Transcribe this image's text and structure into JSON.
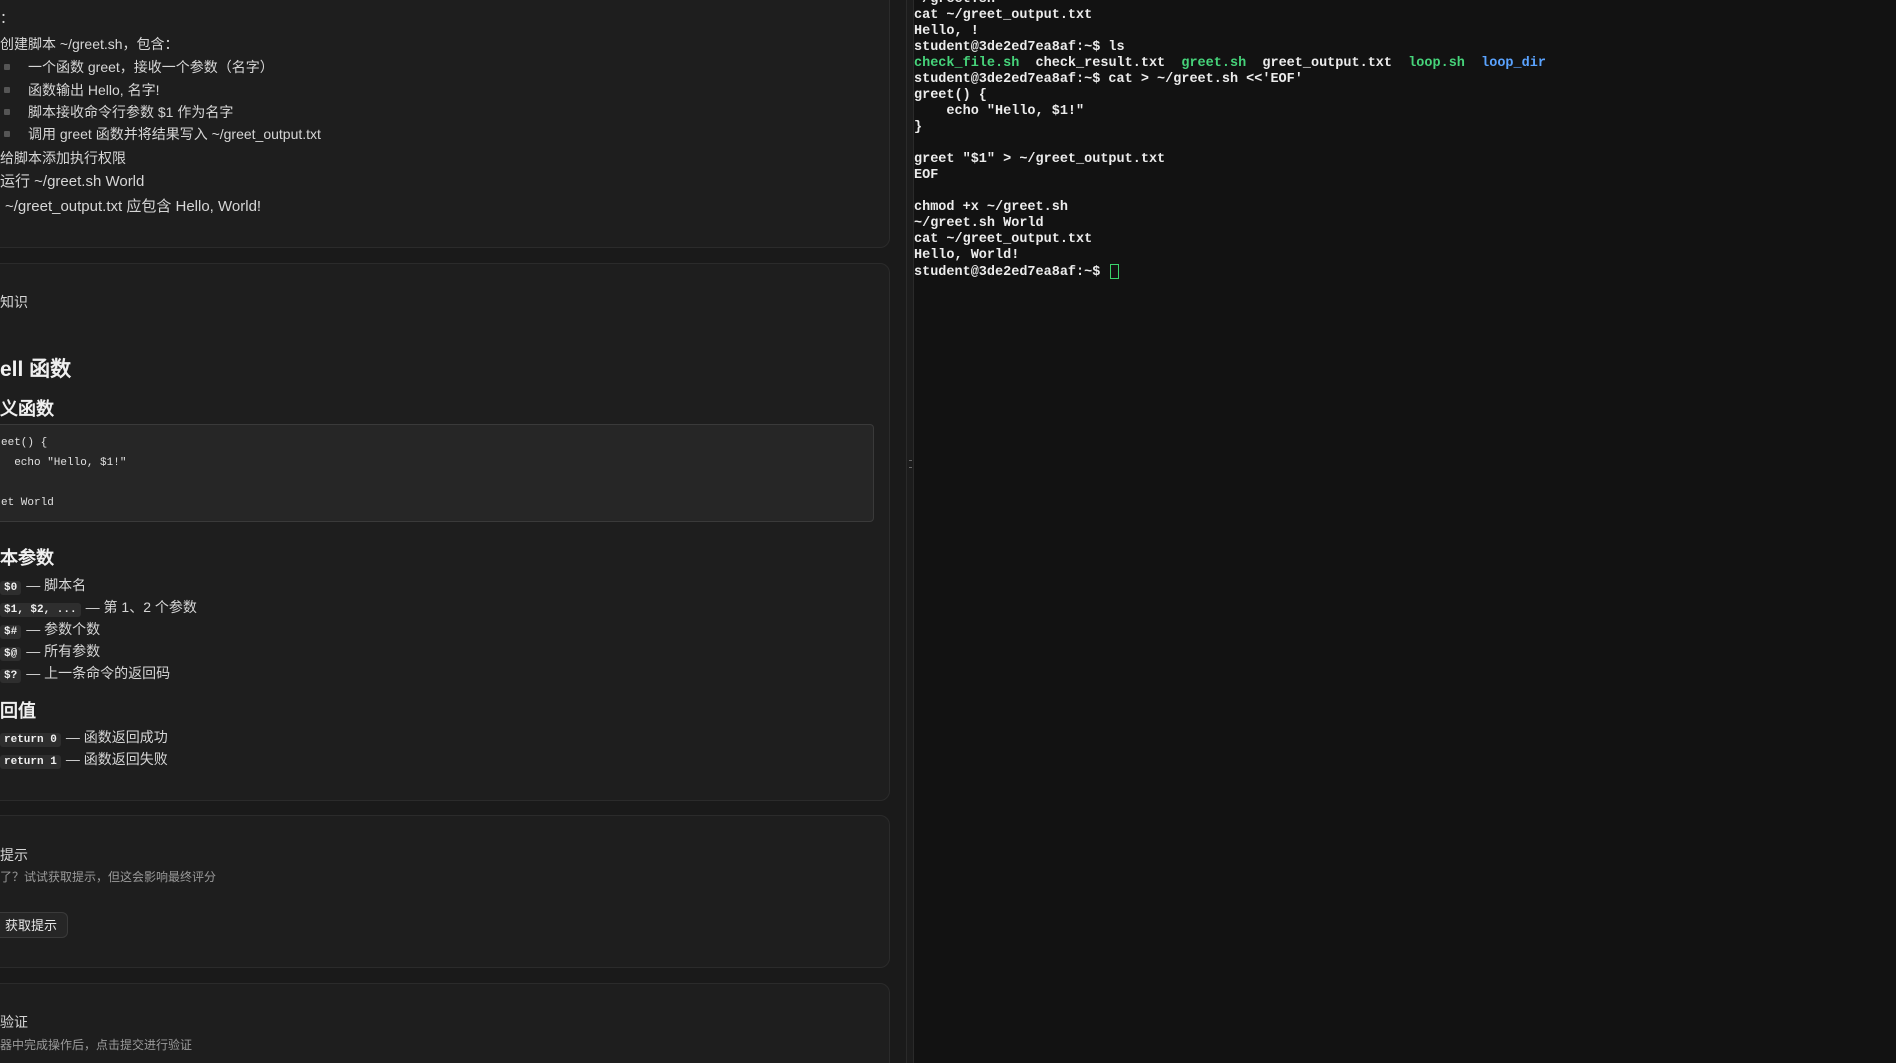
{
  "task": {
    "intro": "：",
    "step1": "创建脚本 ~/greet.sh，包含：",
    "bullets": [
      "一个函数 greet，接收一个参数（名字）",
      "函数输出 Hello, 名字!",
      "脚本接收命令行参数 $1 作为名字",
      "调用 greet 函数并将结果写入 ~/greet_output.txt"
    ],
    "step2": "给脚本添加执行权限",
    "step3": "运行 ~/greet.sh World",
    "expect": "~/greet_output.txt 应包含 Hello, World!"
  },
  "knowledge": {
    "title": "知识",
    "h_main": "ell 函数",
    "h_define": "义函数",
    "code": [
      "eet() {",
      "  echo \"Hello, $1!\"",
      "",
      "et World"
    ],
    "h_params": "本参数",
    "params": [
      {
        "code": "$0",
        "desc": "— 脚本名"
      },
      {
        "code": "$1, $2, ...",
        "desc": "— 第 1、2 个参数"
      },
      {
        "code": "$#",
        "desc": "— 参数个数"
      },
      {
        "code": "$@",
        "desc": "— 所有参数"
      },
      {
        "code": "$?",
        "desc": "— 上一条命令的返回码"
      }
    ],
    "h_return": "回值",
    "returns": [
      {
        "code": "return 0",
        "desc": "— 函数返回成功"
      },
      {
        "code": "return 1",
        "desc": "— 函数返回失败"
      }
    ]
  },
  "hint": {
    "title": "提示",
    "desc": "了？试试获取提示，但这会影响最终评分",
    "button": "获取提示"
  },
  "verify": {
    "title": "验证",
    "desc": "器中完成操作后，点击提交进行验证"
  },
  "terminal": {
    "lines": [
      "~/greet.sh",
      "cat ~/greet_output.txt",
      "Hello, !",
      "student@3de2ed7ea8af:~$ ls",
      "__LS__",
      "student@3de2ed7ea8af:~$ cat > ~/greet.sh <<'EOF'",
      "greet() {",
      "    echo \"Hello, $1!\"",
      "}",
      "",
      "greet \"$1\" > ~/greet_output.txt",
      "EOF",
      "",
      "chmod +x ~/greet.sh",
      "~/greet.sh World",
      "cat ~/greet_output.txt",
      "Hello, World!"
    ],
    "ls_entries": [
      {
        "name": "check_file.sh",
        "kind": "exec"
      },
      {
        "name": "check_result.txt",
        "kind": "file"
      },
      {
        "name": "greet.sh",
        "kind": "exec"
      },
      {
        "name": "greet_output.txt",
        "kind": "file"
      },
      {
        "name": "loop.sh",
        "kind": "exec"
      },
      {
        "name": "loop_dir",
        "kind": "dir"
      }
    ],
    "prompt": "student@3de2ed7ea8af:~$ ",
    "colors": {
      "exec": "#46d37a",
      "dir": "#5aa3ff",
      "text": "#ececec"
    }
  }
}
